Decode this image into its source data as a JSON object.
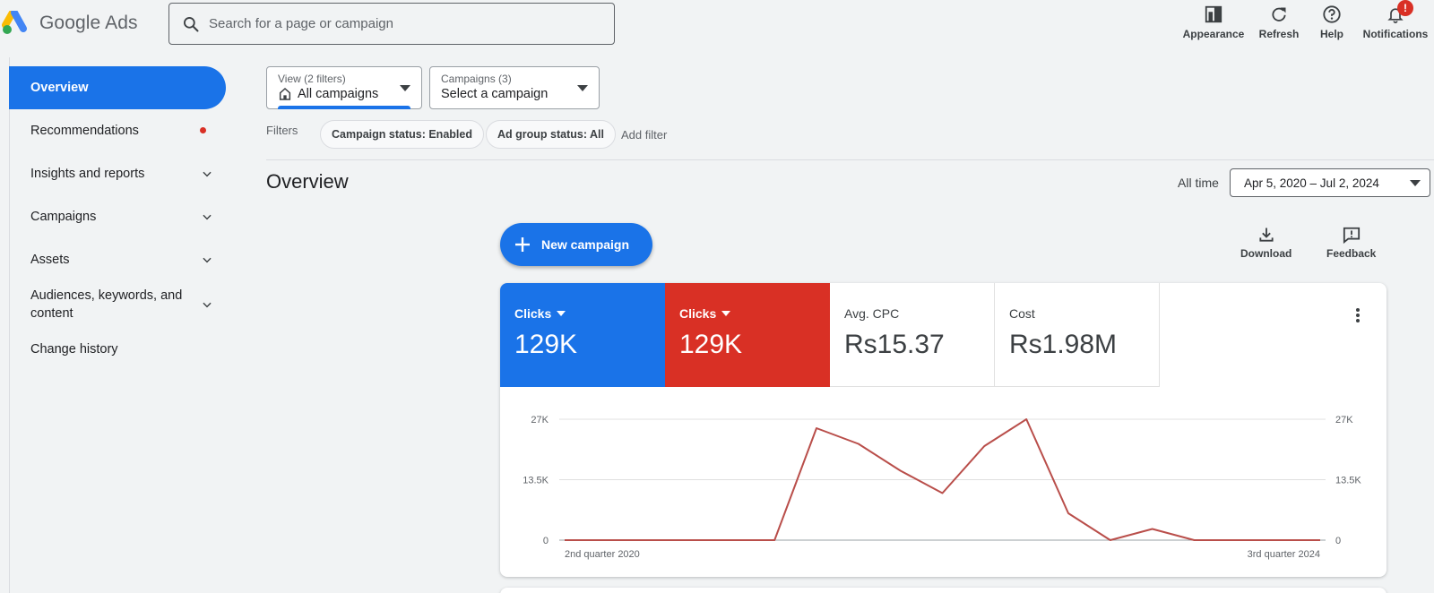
{
  "app": {
    "logo_text": "Google Ads"
  },
  "search": {
    "placeholder": "Search for a page or campaign"
  },
  "header_actions": [
    {
      "label": "Appearance",
      "icon": "appearance-icon"
    },
    {
      "label": "Refresh",
      "icon": "refresh-icon"
    },
    {
      "label": "Help",
      "icon": "help-icon"
    },
    {
      "label": "Notifications",
      "icon": "notifications-icon",
      "badge": "!"
    }
  ],
  "sidebar": {
    "items": [
      {
        "label": "Overview",
        "active": true
      },
      {
        "label": "Recommendations",
        "dot": true
      },
      {
        "label": "Insights and reports",
        "expandable": true
      },
      {
        "label": "Campaigns",
        "expandable": true
      },
      {
        "label": "Assets",
        "expandable": true
      },
      {
        "label": "Audiences, keywords, and content",
        "expandable": true
      },
      {
        "label": "Change history"
      }
    ]
  },
  "view_selector": {
    "small": "View (2 filters)",
    "value": "All campaigns"
  },
  "campaign_selector": {
    "small": "Campaigns (3)",
    "value": "Select a campaign"
  },
  "filters": {
    "label": "Filters",
    "chips": [
      "Campaign status: Enabled",
      "Ad group status: All"
    ],
    "add_label": "Add filter"
  },
  "overview": {
    "title": "Overview",
    "range_label": "All time",
    "date_range": "Apr 5, 2020 – Jul 2, 2024",
    "new_campaign": "New campaign",
    "download": "Download",
    "feedback": "Feedback"
  },
  "metrics": [
    {
      "label": "Clicks",
      "value": "129K",
      "dropdown": true,
      "color": "#1a73e8"
    },
    {
      "label": "Clicks",
      "value": "129K",
      "dropdown": true,
      "color": "#d93025"
    },
    {
      "label": "Avg. CPC",
      "value": "Rs15.37"
    },
    {
      "label": "Cost",
      "value": "Rs1.98M"
    }
  ],
  "chart_data": {
    "type": "line",
    "x_start_label": "2nd quarter 2020",
    "x_end_label": "3rd quarter 2024",
    "y_ticks_left": [
      "27K",
      "13.5K",
      "0"
    ],
    "y_ticks_right": [
      "27K",
      "13.5K",
      "0"
    ],
    "ylim": [
      0,
      27000
    ],
    "series": [
      {
        "color": "#b94e4a",
        "values": [
          0,
          0,
          0,
          0,
          0,
          0,
          25000,
          21500,
          15500,
          10500,
          21000,
          27000,
          6000,
          0,
          2500,
          0,
          0,
          0,
          0
        ]
      }
    ]
  }
}
